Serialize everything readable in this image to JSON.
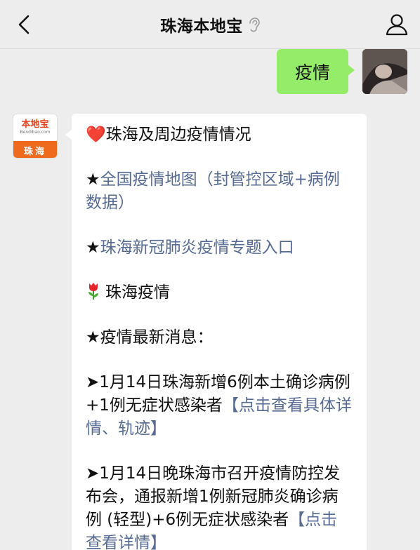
{
  "navbar": {
    "title": "珠海本地宝"
  },
  "outgoing": {
    "text": "疫情"
  },
  "bot_avatar": {
    "logo_text": "本地宝",
    "logo_sub": "Bendibao.com",
    "city": "珠海"
  },
  "message": {
    "header": {
      "heart": "❤️",
      "text": "珠海及周边疫情情况"
    },
    "map_link": {
      "star": "★",
      "link": "全国疫情地图（封管控区域+病例数据）"
    },
    "topic_link": {
      "star": "★",
      "link": "珠海新冠肺炎疫情专题入口"
    },
    "section": {
      "text": "珠海疫情"
    },
    "latest": {
      "star": "★",
      "text": "疫情最新消息："
    },
    "news1": {
      "arrow": "➤",
      "text": "1月14日珠海新增6例本土确诊病例+1例无症状感染者",
      "link": "【点击查看具体详情、轨迹】"
    },
    "news2": {
      "arrow": "➤",
      "text": "1月14日晚珠海市召开疫情防控发布会，通报新增1例新冠肺炎确诊病例 (轻型)+6例无症状感染者",
      "link": "【点击查看详情】"
    }
  }
}
